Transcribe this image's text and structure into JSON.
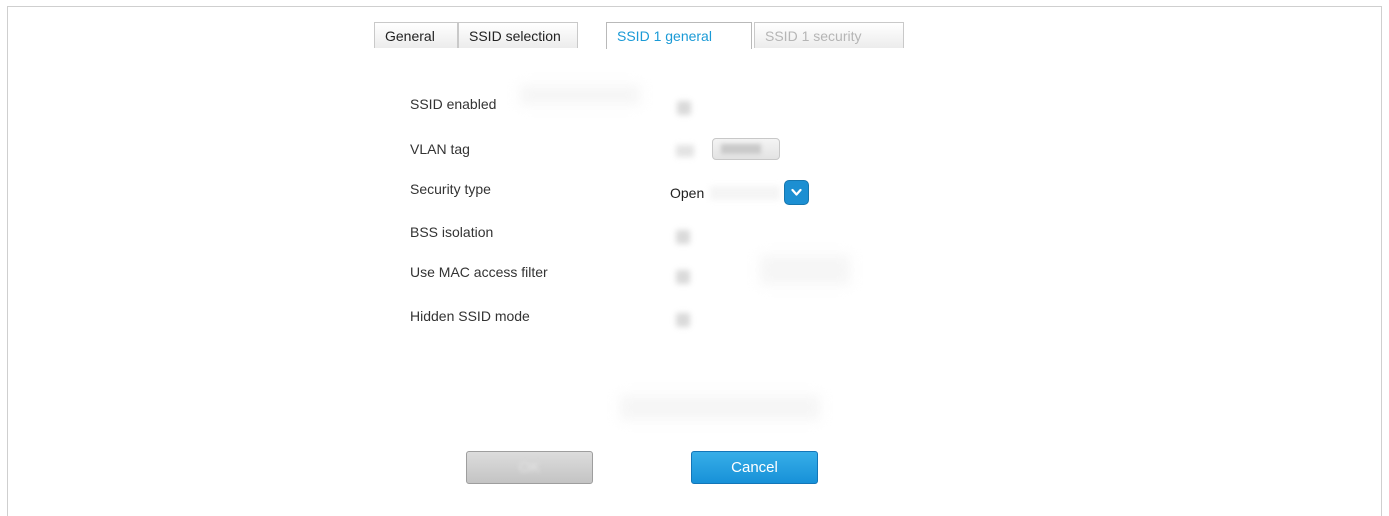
{
  "tabs": [
    {
      "label": "General",
      "state": "normal"
    },
    {
      "label": "SSID selection",
      "state": "normal"
    },
    {
      "label": "SSID 1 general",
      "state": "active"
    },
    {
      "label": "SSID 1 security",
      "state": "disabled"
    }
  ],
  "form": {
    "ssid_enabled_label": "SSID enabled",
    "vlan_tag_label": "VLAN tag",
    "security_type_label": "Security type",
    "security_type_value": "Open",
    "bss_isolation_label": "BSS isolation",
    "mac_filter_label": "Use MAC access filter",
    "hidden_ssid_label": "Hidden SSID mode"
  },
  "buttons": {
    "ok_label": "OK",
    "cancel_label": "Cancel"
  },
  "colors": {
    "accent": "#1a9ad6",
    "cancel_button": "#1791d8",
    "select_button": "#1c8fd2"
  },
  "icons": {
    "select_dropdown": "chevron-down-icon"
  }
}
